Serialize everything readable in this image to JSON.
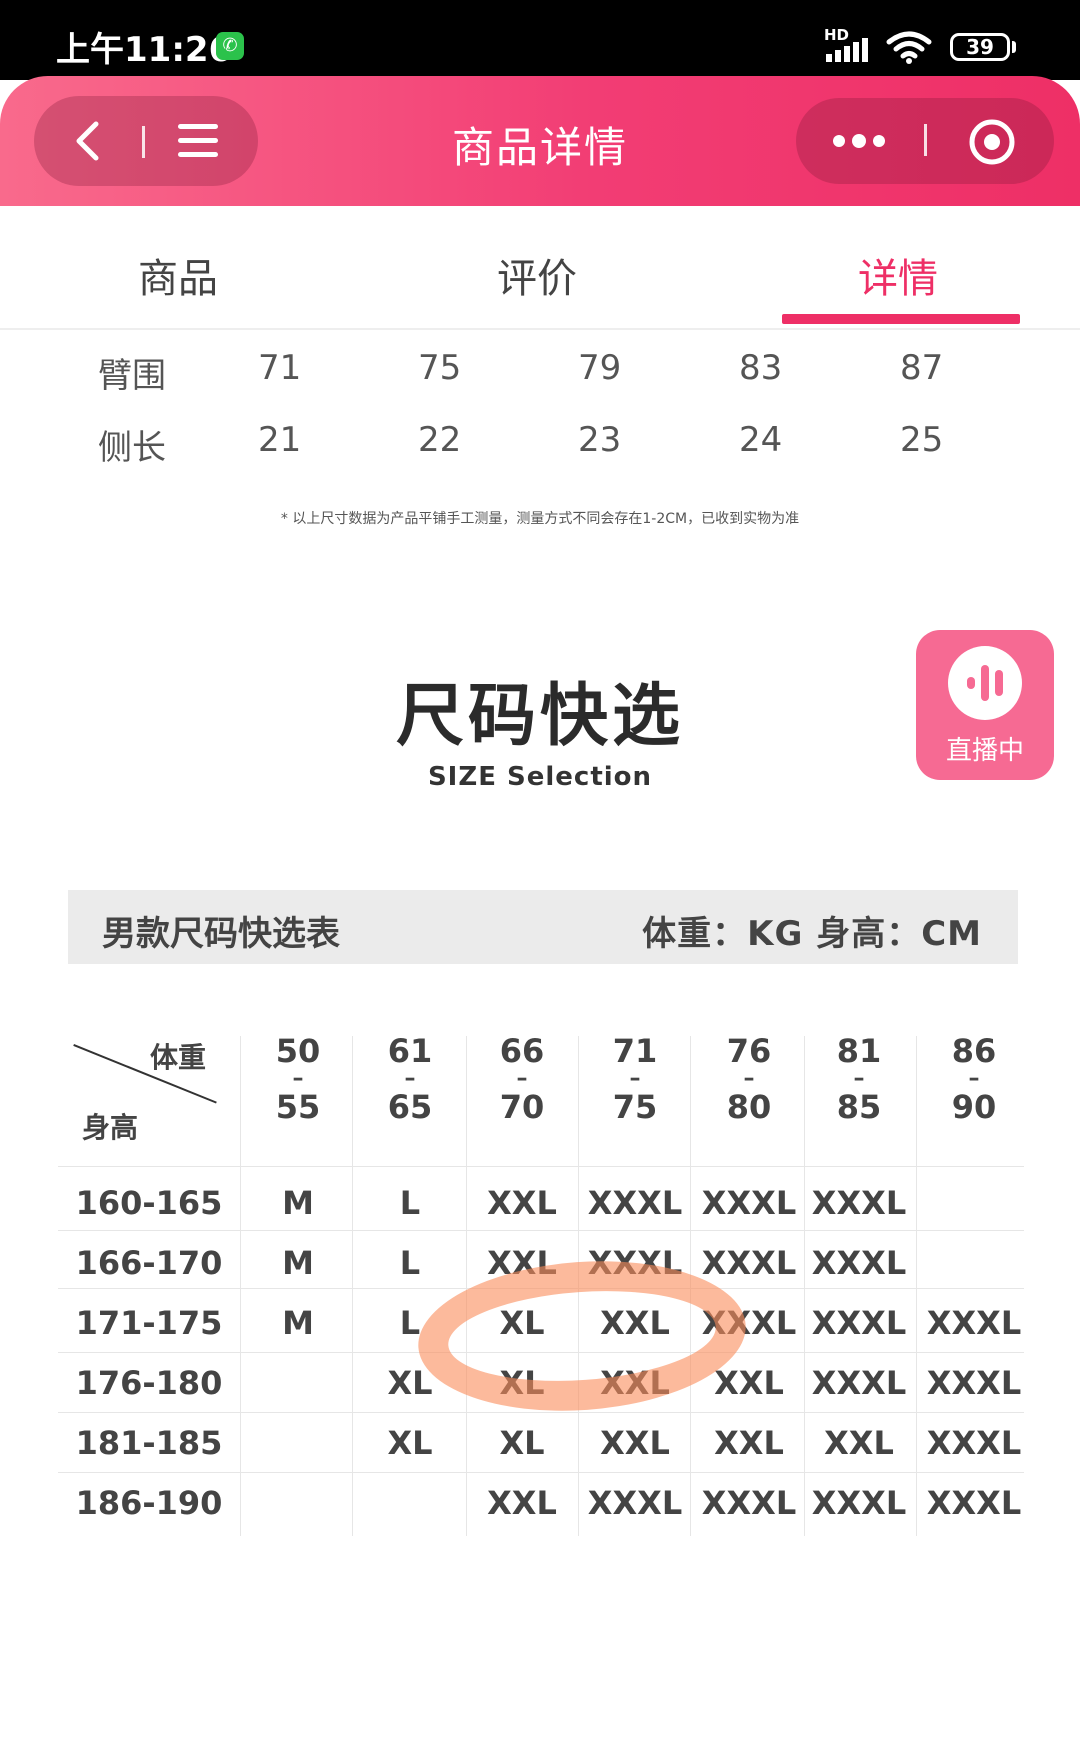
{
  "status_bar": {
    "time": "上午11:26",
    "network": "HD",
    "battery": "39"
  },
  "nav": {
    "title": "商品详情"
  },
  "tabs": [
    {
      "label": "商品",
      "active": false
    },
    {
      "label": "评价",
      "active": false
    },
    {
      "label": "详情",
      "active": true
    }
  ],
  "measure_table": {
    "rows": [
      {
        "label": "臂围",
        "values": [
          "71",
          "75",
          "79",
          "83",
          "87"
        ]
      },
      {
        "label": "侧长",
        "values": [
          "21",
          "22",
          "23",
          "24",
          "25"
        ]
      }
    ],
    "note": "* 以上尺寸数据为产品平铺手工测量，测量方式不同会存在1-2CM，已收到实物为准"
  },
  "size_section": {
    "title": "尺码快选",
    "subtitle": "SIZE Selection"
  },
  "live_badge": {
    "label": "直播中"
  },
  "size_table": {
    "header_title": "男款尺码快选表",
    "header_unit": "体重：KG  身高：CM",
    "corner_weight": "体重",
    "corner_height": "身高",
    "weight_columns": [
      {
        "top": "50",
        "dash": "–",
        "bottom": "55"
      },
      {
        "top": "61",
        "dash": "–",
        "bottom": "65"
      },
      {
        "top": "66",
        "dash": "–",
        "bottom": "70"
      },
      {
        "top": "71",
        "dash": "–",
        "bottom": "75"
      },
      {
        "top": "76",
        "dash": "–",
        "bottom": "80"
      },
      {
        "top": "81",
        "dash": "–",
        "bottom": "85"
      },
      {
        "top": "86",
        "dash": "–",
        "bottom": "90"
      }
    ],
    "rows": [
      {
        "height": "160-165",
        "sizes": [
          "M",
          "L",
          "XXL",
          "XXXL",
          "XXXL",
          "XXXL",
          ""
        ]
      },
      {
        "height": "166-170",
        "sizes": [
          "M",
          "L",
          "XXL",
          "XXXL",
          "XXXL",
          "XXXL",
          ""
        ]
      },
      {
        "height": "171-175",
        "sizes": [
          "M",
          "L",
          "XL",
          "XXL",
          "XXXL",
          "XXXL",
          "XXXL"
        ]
      },
      {
        "height": "176-180",
        "sizes": [
          "",
          "XL",
          "XL",
          "XXL",
          "XXL",
          "XXXL",
          "XXXL"
        ]
      },
      {
        "height": "181-185",
        "sizes": [
          "",
          "XL",
          "XL",
          "XXL",
          "XXL",
          "XXL",
          "XXXL"
        ]
      },
      {
        "height": "186-190",
        "sizes": [
          "",
          "",
          "XXL",
          "XXXL",
          "XXXL",
          "XXXL",
          "XXXL"
        ]
      }
    ]
  },
  "colors": {
    "accent": "#ee2f66",
    "highlight": "#f98c5a"
  }
}
